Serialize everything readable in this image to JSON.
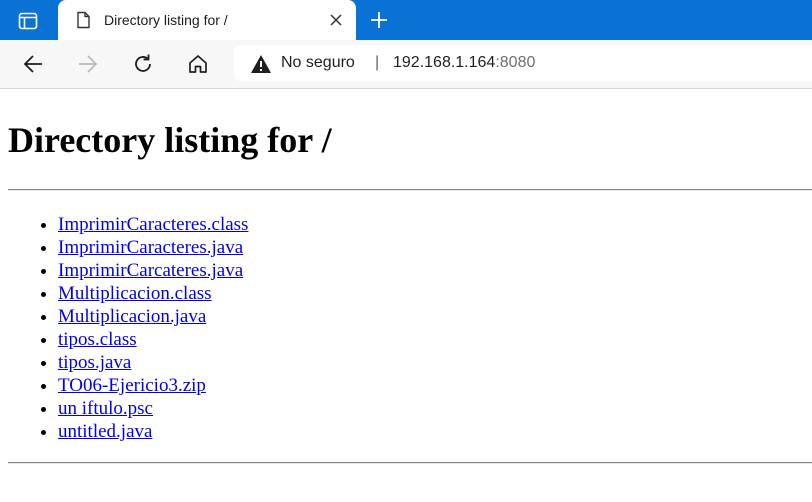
{
  "browser": {
    "tab": {
      "title": "Directory listing for /"
    },
    "address_bar": {
      "security_label": "No seguro",
      "separator": "|",
      "url_host": "192.168.1.164",
      "url_port": ":8080"
    }
  },
  "page": {
    "heading": "Directory listing for /",
    "files": [
      {
        "name": "ImprimirCaracteres.class"
      },
      {
        "name": "ImprimirCaracteres.java"
      },
      {
        "name": "ImprimirCarcateres.java"
      },
      {
        "name": "Multiplicacion.class"
      },
      {
        "name": "Multiplicacion.java"
      },
      {
        "name": "tipos.class"
      },
      {
        "name": "tipos.java"
      },
      {
        "name": "TO06-Ejericio3.zip"
      },
      {
        "name": "un iftulo.psc"
      },
      {
        "name": "untitled.java"
      }
    ]
  },
  "colors": {
    "tabstrip": "#0a72d4",
    "link": "#0000ee",
    "toolbar": "#f7f7f7"
  },
  "icons": [
    "tab-actions-icon",
    "page-icon",
    "close-icon",
    "new-tab-icon",
    "back-icon",
    "forward-icon",
    "refresh-icon",
    "home-icon",
    "warning-icon"
  ]
}
